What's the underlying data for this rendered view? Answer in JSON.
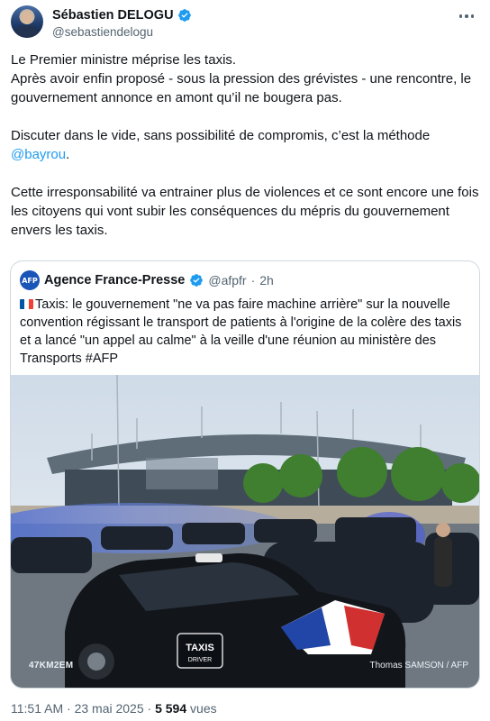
{
  "author": {
    "display_name": "Sébastien DELOGU",
    "handle": "@sebastiendelogu",
    "avatar_icon": "avatar-photo",
    "verified_icon": "verified-badge-icon"
  },
  "more_icon": "more-horizontal-icon",
  "tweet": {
    "line1": "Le Premier ministre méprise les taxis.",
    "line2": "Après avoir enfin proposé - sous la pression des grévistes - une rencontre, le gouvernement annonce en amont qu’il ne bougera pas.",
    "line3_prefix": "Discuter dans le vide, sans possibilité de compromis, c’est la méthode ",
    "mention": "@bayrou",
    "line3_suffix": ".",
    "line4": "Cette irresponsabilité va entrainer plus de violences et ce sont encore une fois les citoyens qui vont subir les conséquences du mépris du gouvernement envers les taxis."
  },
  "quote": {
    "logo_text": "AFP",
    "name": "Agence France-Presse",
    "handle": "@afpfr",
    "separator": "·",
    "time": "2h",
    "text": "Taxis: le gouvernement \"ne va pas faire machine arrière\" sur la nouvelle convention régissant le transport de patients à l'origine de la colère des taxis et a lancé \"un appel au calme\" à la veille d'une réunion au ministère des Transports #AFP",
    "image": {
      "plate_text": "47KM2EM",
      "credit": "Thomas SAMSON / AFP",
      "sign_line1": "TAXIS",
      "sign_line2": "DRIVER"
    }
  },
  "meta": {
    "time": "11:51 AM",
    "dot": "·",
    "date": "23 mai 2025",
    "dot2": "·",
    "views_count": "5 594",
    "views_label": "vues"
  },
  "colors": {
    "link": "#1d9bf0",
    "verified": "#1d9bf0",
    "secondary_text": "#536471",
    "afp_blue": "#1a55b8"
  }
}
